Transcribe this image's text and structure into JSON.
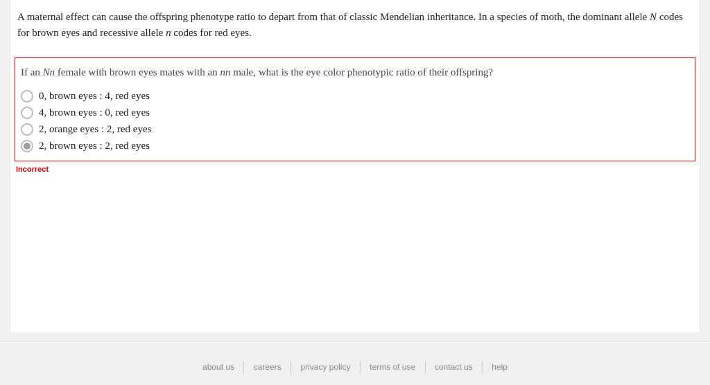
{
  "intro": {
    "part1": "A maternal effect can cause the offspring phenotype ratio to depart from that of classic Mendelian inheritance. In a species of moth, the dominant allele ",
    "N": "N",
    "part2": " codes for brown eyes and recessive allele ",
    "n": "n",
    "part3": " codes for red eyes."
  },
  "question": {
    "p1": "If an ",
    "g1": "Nn",
    "p2": " female with brown eyes mates with an ",
    "g2": "nn",
    "p3": " male, what is the eye color phenotypic ratio of their offspring?"
  },
  "options": [
    {
      "label": "0, brown eyes : 4, red eyes",
      "selected": false
    },
    {
      "label": "4, brown eyes : 0, red eyes",
      "selected": false
    },
    {
      "label": "2, orange eyes : 2, red eyes",
      "selected": false
    },
    {
      "label": "2, brown eyes : 2, red eyes",
      "selected": true
    }
  ],
  "feedback": "Incorrect",
  "footer": {
    "about": "about us",
    "careers": "careers",
    "privacy": "privacy policy",
    "terms": "terms of use",
    "contact": "contact us",
    "help": "help"
  }
}
